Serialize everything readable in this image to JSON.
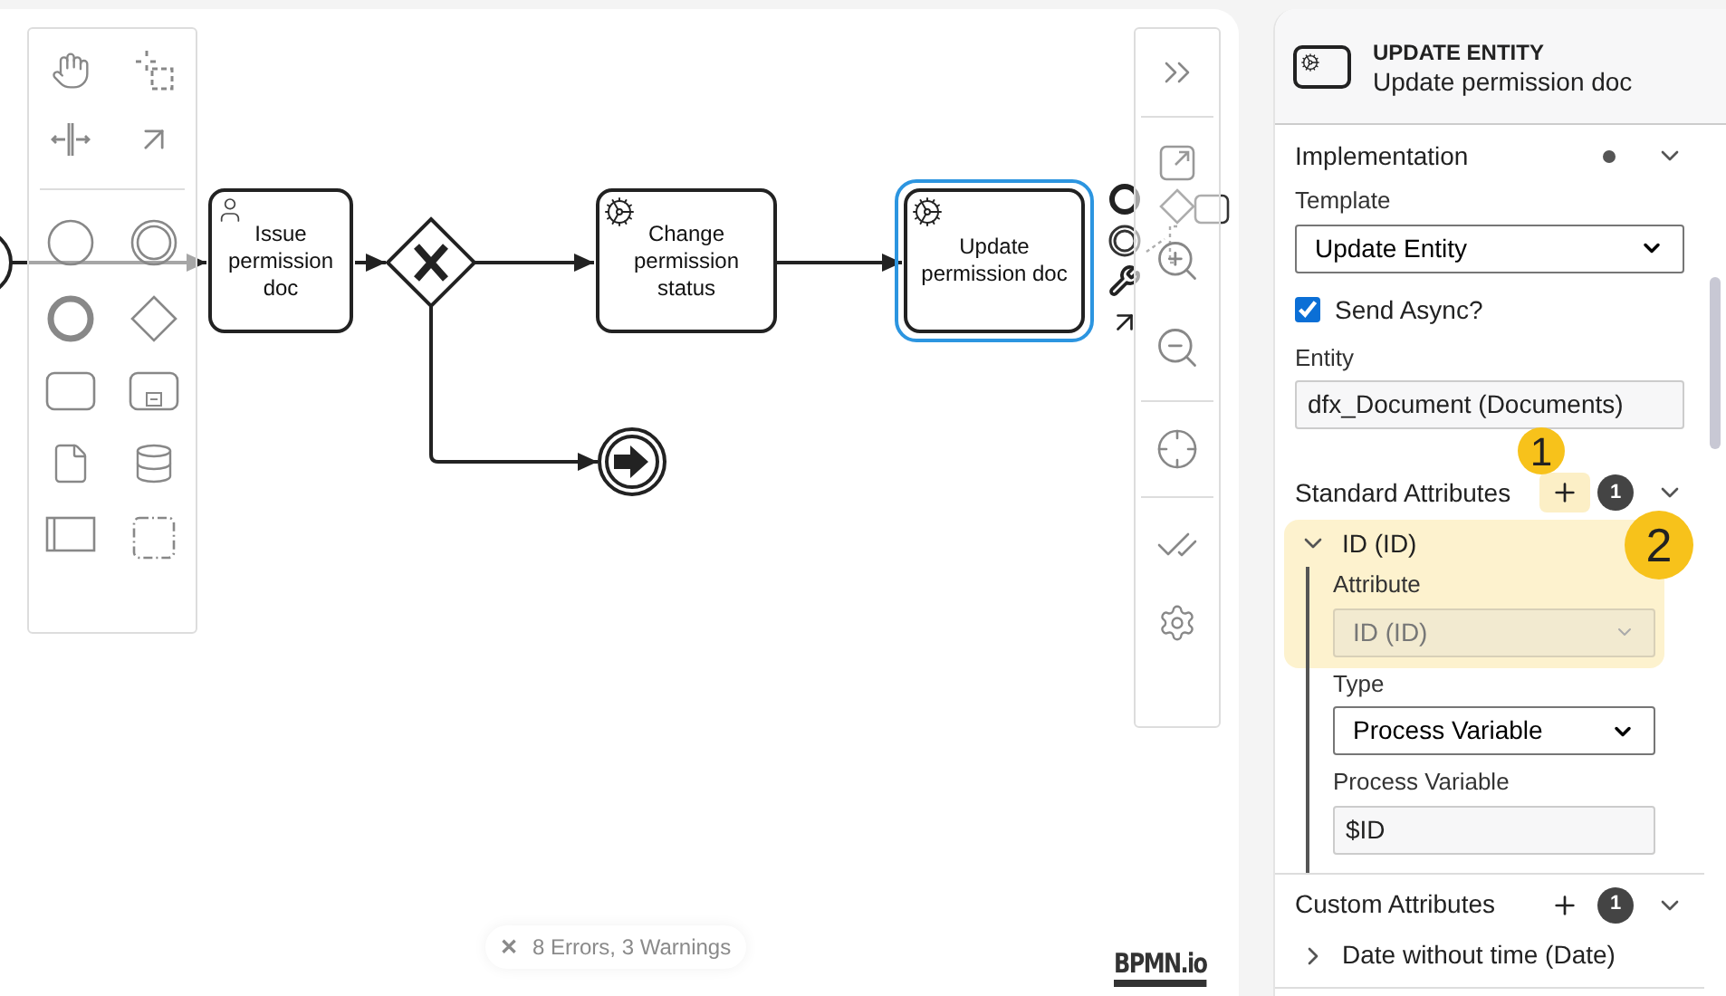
{
  "diagram": {
    "tasks": [
      {
        "label": "Issue permission doc",
        "kind": "user",
        "selected": false
      },
      {
        "label": "Change permission status",
        "kind": "service",
        "selected": false
      },
      {
        "label": "Update permission doc",
        "kind": "service",
        "selected": true
      }
    ]
  },
  "status": {
    "problems": "8 Errors, 3 Warnings",
    "close": "✕"
  },
  "logo": "BPMN.io",
  "properties": {
    "header": {
      "type": "UPDATE ENTITY",
      "name": "Update permission doc"
    },
    "groups": [
      {
        "title": "Implementation",
        "has_changes": true,
        "expanded": true,
        "entries": [
          {
            "kind": "select",
            "label": "Template",
            "value": "Update Entity",
            "disabled": false
          },
          {
            "kind": "checkbox",
            "label": "Send Async?",
            "checked": true
          },
          {
            "kind": "text",
            "label": "Entity",
            "value": "dfx_Document (Documents)"
          }
        ]
      },
      {
        "title": "Standard Attributes",
        "count": "1",
        "add_highlighted": true,
        "expanded": true,
        "items": [
          {
            "title": "ID (ID)",
            "expanded": true,
            "highlighted": true,
            "entries": [
              {
                "kind": "select",
                "label": "Attribute",
                "value": "ID (ID)",
                "disabled": true
              },
              {
                "kind": "select",
                "label": "Type",
                "value": "Process Variable",
                "disabled": false
              },
              {
                "kind": "text",
                "label": "Process Variable",
                "value": "$ID"
              }
            ]
          }
        ]
      },
      {
        "title": "Custom Attributes",
        "count": "1",
        "add_highlighted": false,
        "expanded": true,
        "items": [
          {
            "title": "Date without time (Date)",
            "expanded": false
          }
        ]
      }
    ]
  },
  "callouts": [
    {
      "number": "1"
    },
    {
      "number": "2"
    }
  ]
}
